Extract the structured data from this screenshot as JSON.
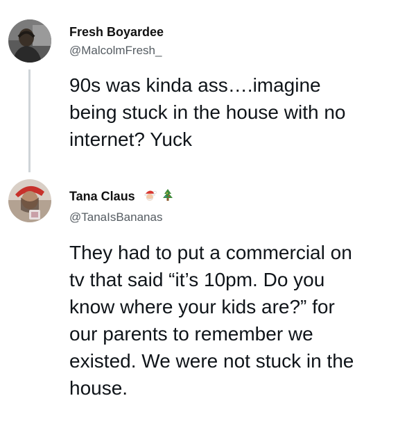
{
  "tweets": [
    {
      "display_name": "Fresh Boyardee",
      "handle": "@MalcolmFresh_",
      "text": "90s was kinda ass….imagine\nbeing stuck in the house with no\ninternet? Yuck"
    },
    {
      "display_name": "Tana Claus",
      "handle": "@TanaIsBananas",
      "text": "They had to put a commercial on\ntv that said “it’s 10pm. Do you\nknow where your kids are?” for\nour parents to remember we\nexisted. We were not stuck in the\nhouse.",
      "name_emojis": [
        "santa-face-icon",
        "christmas-tree-icon"
      ]
    }
  ],
  "colors": {
    "text": "#0f1419",
    "handle": "#555c62",
    "thread_line": "#cfd4d8"
  }
}
